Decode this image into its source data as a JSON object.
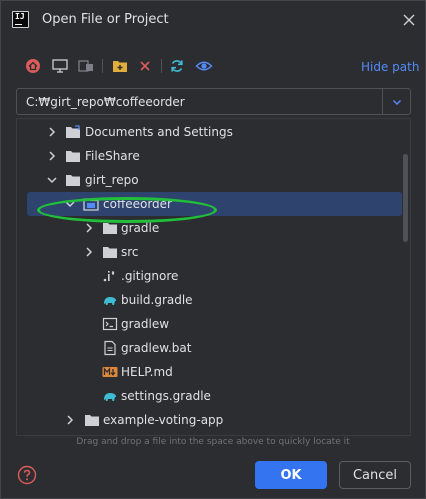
{
  "window": {
    "title": "Open File or Project"
  },
  "toolbar": {
    "icons": [
      "home-icon",
      "desktop-icon",
      "project-icon",
      "new-folder-icon",
      "delete-icon",
      "refresh-icon",
      "show-hidden-icon"
    ],
    "hide_path_label": "Hide path"
  },
  "path": {
    "value": "C:₩girt_repo₩coffeeorder"
  },
  "tree": {
    "items": [
      {
        "label": "Documents and Settings",
        "icon": "folder-link-icon",
        "chevron": "right"
      },
      {
        "label": "FileShare",
        "icon": "folder-icon",
        "chevron": "right"
      },
      {
        "label": "girt_repo",
        "icon": "folder-icon",
        "chevron": "down"
      },
      {
        "label": "coffeeorder",
        "icon": "module-folder-icon",
        "chevron": "down",
        "selected": true
      },
      {
        "label": "gradle",
        "icon": "folder-icon",
        "chevron": "right"
      },
      {
        "label": "src",
        "icon": "folder-icon",
        "chevron": "right"
      },
      {
        "label": ".gitignore",
        "icon": "gitignore-icon",
        "chevron": "none"
      },
      {
        "label": "build.gradle",
        "icon": "gradle-elephant-icon",
        "chevron": "none"
      },
      {
        "label": "gradlew",
        "icon": "terminal-script-icon",
        "chevron": "none"
      },
      {
        "label": "gradlew.bat",
        "icon": "text-file-icon",
        "chevron": "none"
      },
      {
        "label": "HELP.md",
        "icon": "markdown-icon",
        "chevron": "none"
      },
      {
        "label": "settings.gradle",
        "icon": "gradle-elephant-icon",
        "chevron": "none"
      },
      {
        "label": "example-voting-app",
        "icon": "folder-icon",
        "chevron": "right"
      }
    ]
  },
  "hint": "Drag and drop a file into the space above to quickly locate it",
  "buttons": {
    "ok": "OK",
    "cancel": "Cancel"
  },
  "colors": {
    "accent": "#3574f0",
    "link": "#548af7",
    "selection": "#2e436e",
    "annotation_ring": "#22c03a"
  }
}
